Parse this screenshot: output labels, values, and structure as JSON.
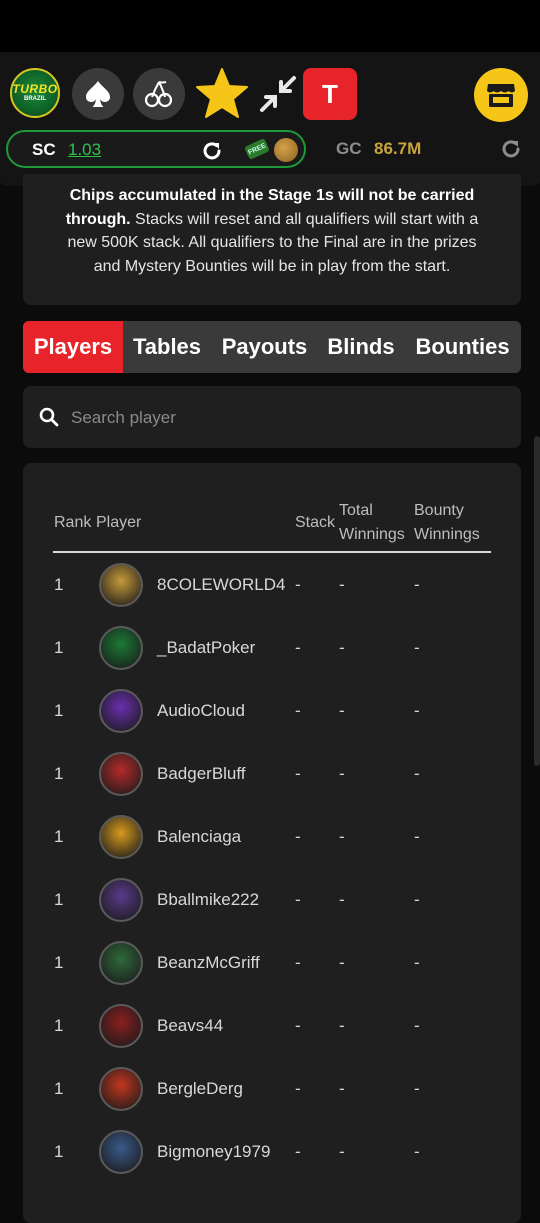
{
  "header": {
    "logo": {
      "line1": "TURBO",
      "line2": "BRAZIL"
    },
    "icons": [
      "spade-icon",
      "cherry-icon",
      "star-icon",
      "shrink-arrows-icon",
      "shop-icon"
    ],
    "t_button_label": "T"
  },
  "balances": {
    "sc_label": "SC",
    "sc_value": "1.03",
    "free_badge": "FREE",
    "gc_label": "GC",
    "gc_value": "86.7M"
  },
  "info": {
    "bold_text": "Chips accumulated in the Stage 1s will not be carried through.",
    "text": " Stacks will reset and all qualifiers will start with a new 500K stack. All qualifiers to the Final are in the prizes and Mystery Bounties will be in play from the start."
  },
  "tabs": [
    {
      "label": "Players",
      "active": true
    },
    {
      "label": "Tables",
      "active": false
    },
    {
      "label": "Payouts",
      "active": false
    },
    {
      "label": "Blinds",
      "active": false
    },
    {
      "label": "Bounties",
      "active": false
    }
  ],
  "search": {
    "placeholder": "Search player"
  },
  "table": {
    "headers": {
      "rank": "Rank",
      "player": "Player",
      "stack": "Stack",
      "total_line1": "Total",
      "total_line2": "Winnings",
      "bounty_line1": "Bounty",
      "bounty_line2": "Winnings"
    },
    "rows": [
      {
        "rank": "1",
        "player": "8COLEWORLD4",
        "stack": "-",
        "total": "-",
        "bounty": "-",
        "avatar_color": "#c79a3b"
      },
      {
        "rank": "1",
        "player": "_BadatPoker",
        "stack": "-",
        "total": "-",
        "bounty": "-",
        "avatar_color": "#1b7a34"
      },
      {
        "rank": "1",
        "player": "AudioCloud",
        "stack": "-",
        "total": "-",
        "bounty": "-",
        "avatar_color": "#6a2fb0"
      },
      {
        "rank": "1",
        "player": "BadgerBluff",
        "stack": "-",
        "total": "-",
        "bounty": "-",
        "avatar_color": "#b52a2a"
      },
      {
        "rank": "1",
        "player": "Balenciaga",
        "stack": "-",
        "total": "-",
        "bounty": "-",
        "avatar_color": "#d69a1e"
      },
      {
        "rank": "1",
        "player": "Bballmike222",
        "stack": "-",
        "total": "-",
        "bounty": "-",
        "avatar_color": "#5a3a8a"
      },
      {
        "rank": "1",
        "player": "BeanzMcGriff",
        "stack": "-",
        "total": "-",
        "bounty": "-",
        "avatar_color": "#2f6a3a"
      },
      {
        "rank": "1",
        "player": "Beavs44",
        "stack": "-",
        "total": "-",
        "bounty": "-",
        "avatar_color": "#8a1f1f"
      },
      {
        "rank": "1",
        "player": "BergleDerg",
        "stack": "-",
        "total": "-",
        "bounty": "-",
        "avatar_color": "#c2371f"
      },
      {
        "rank": "1",
        "player": "Bigmoney1979",
        "stack": "-",
        "total": "-",
        "bounty": "-",
        "avatar_color": "#3a5a8a"
      }
    ]
  }
}
